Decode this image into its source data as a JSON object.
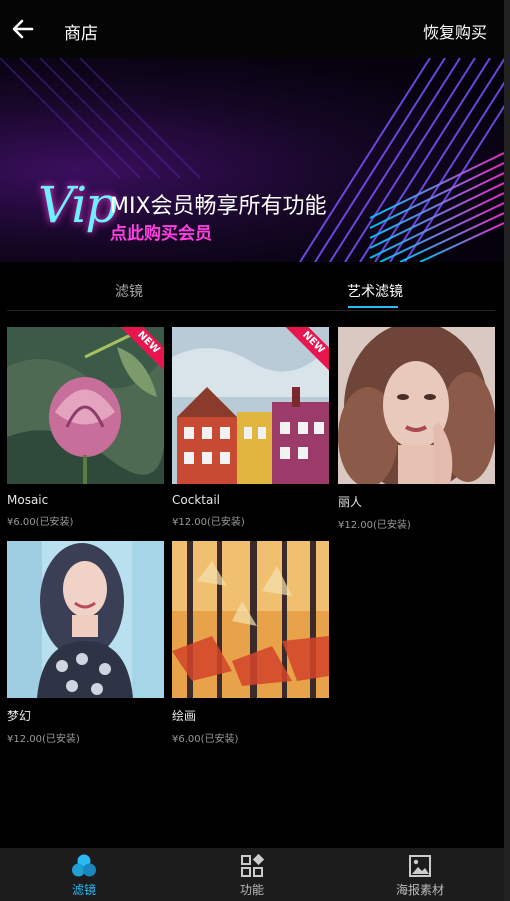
{
  "header": {
    "back_icon": "back-arrow-icon",
    "title": "商店",
    "restore_label": "恢复购买"
  },
  "banner": {
    "vip_text": "Vip",
    "headline": "MIX会员畅享所有功能",
    "subline": "点此购买会员"
  },
  "tabs": [
    {
      "label": "滤镜",
      "active": false
    },
    {
      "label": "艺术滤镜",
      "active": true
    }
  ],
  "items": [
    {
      "name": "Mosaic",
      "price": "¥6.00(已安装)",
      "badge": "NEW"
    },
    {
      "name": "Cocktail",
      "price": "¥12.00(已安装)",
      "badge": "NEW"
    },
    {
      "name": "丽人",
      "price": "¥12.00(已安装)"
    },
    {
      "name": "梦幻",
      "price": "¥12.00(已安装)"
    },
    {
      "name": "绘画",
      "price": "¥6.00(已安装)"
    }
  ],
  "bottom_nav": [
    {
      "label": "滤镜",
      "icon": "filter-circles-icon",
      "active": true
    },
    {
      "label": "功能",
      "icon": "grid-tools-icon",
      "active": false
    },
    {
      "label": "海报素材",
      "icon": "image-icon",
      "active": false
    }
  ],
  "colors": {
    "accent": "#29b9f4",
    "badge": "#e8154f",
    "banner_pink": "#ff3fe0"
  }
}
